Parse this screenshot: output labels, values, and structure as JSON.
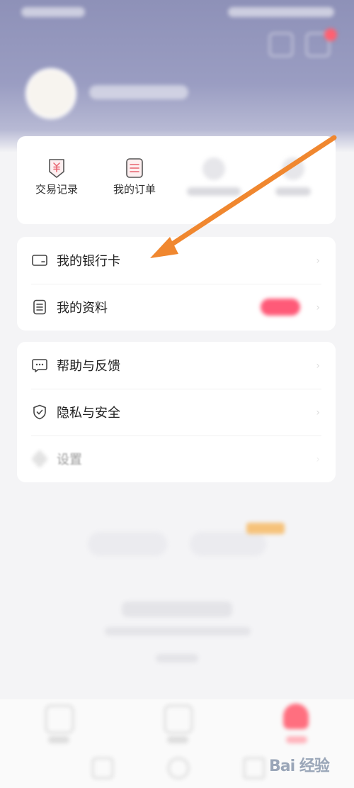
{
  "shortcuts": [
    {
      "label": "交易记录",
      "icon": "yuan-receipt-icon"
    },
    {
      "label": "我的订单",
      "icon": "order-list-icon"
    },
    {
      "label": "",
      "icon": "blurred-icon"
    },
    {
      "label": "",
      "icon": "blurred-icon"
    }
  ],
  "account_group": [
    {
      "label": "我的银行卡",
      "icon": "bank-card-icon"
    },
    {
      "label": "我的资料",
      "icon": "profile-document-icon"
    }
  ],
  "support_group": [
    {
      "label": "帮助与反馈",
      "icon": "chat-bubble-icon"
    },
    {
      "label": "隐私与安全",
      "icon": "shield-check-icon"
    },
    {
      "label": "设置",
      "icon": "settings-icon"
    }
  ],
  "watermark": {
    "text": "Bai 经验"
  },
  "colors": {
    "header": "#9a9dc2",
    "accent_red": "#ff5a78",
    "annotation_arrow": "#f0872f",
    "icon_pink": "#e8626e"
  }
}
